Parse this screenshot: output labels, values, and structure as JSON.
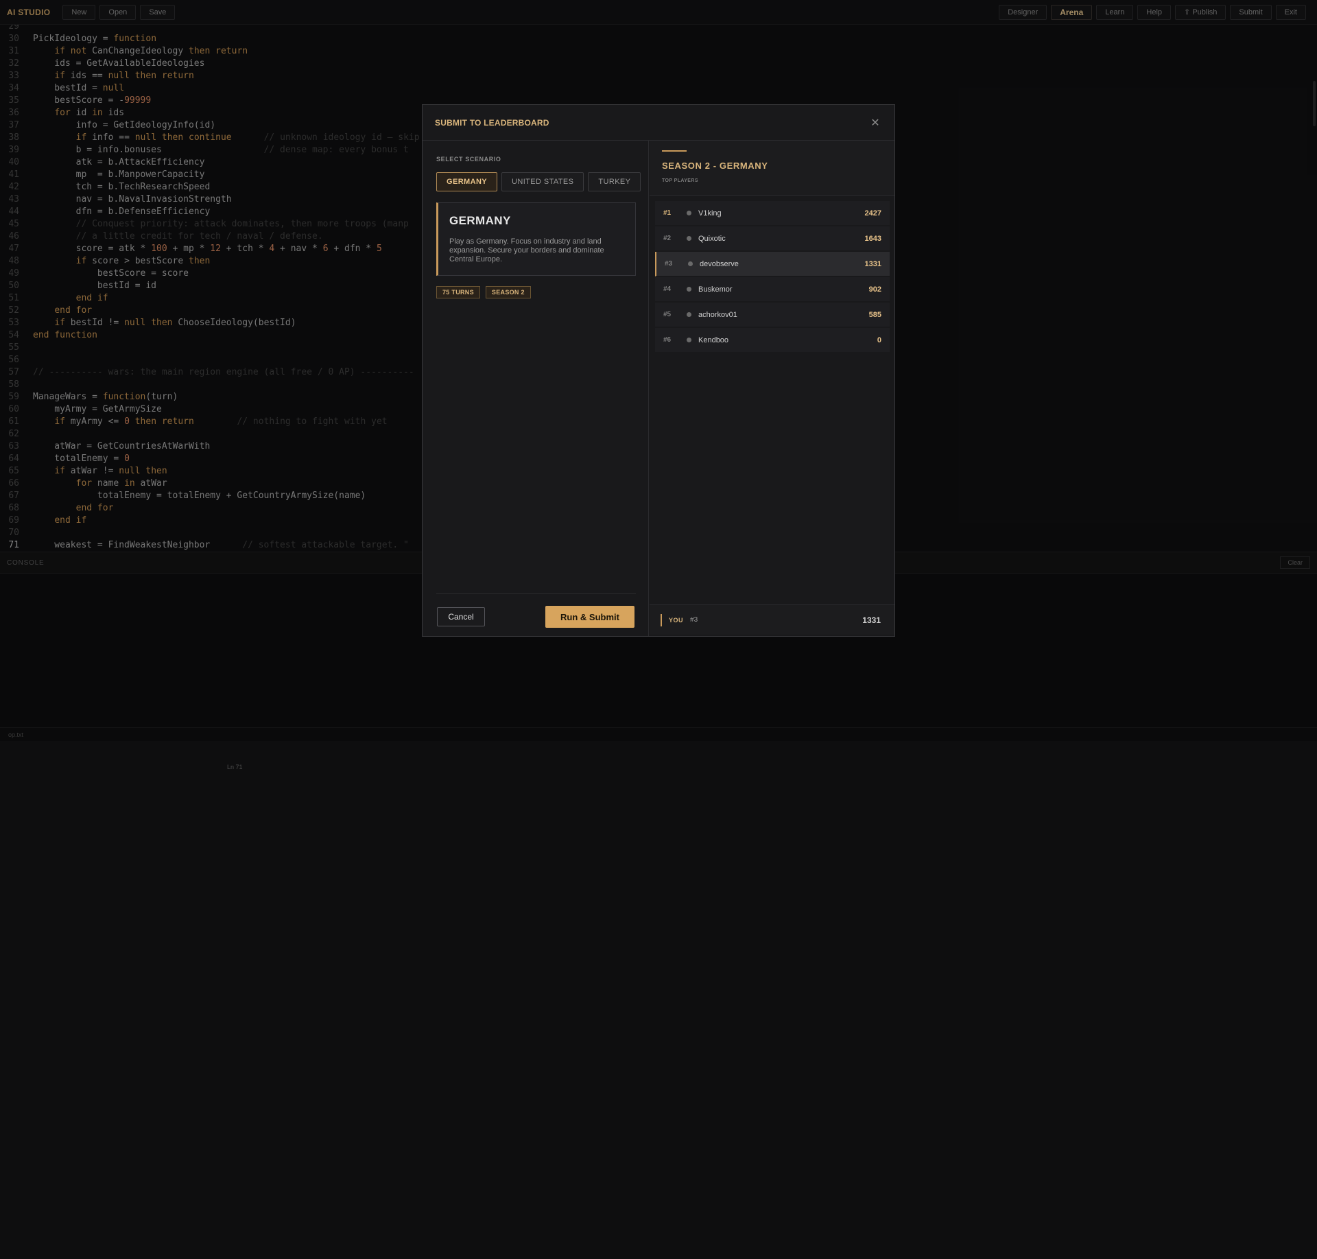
{
  "app": {
    "brand": "AI STUDIO",
    "left_buttons": [
      "New",
      "Open",
      "Save"
    ],
    "right_buttons": [
      "Designer",
      "Arena",
      "Learn",
      "Help",
      "⇧ Publish",
      "Submit",
      "Exit"
    ],
    "active_button": "Arena"
  },
  "editor": {
    "current_line": "71",
    "lines": [
      {
        "n": "29",
        "code": ""
      },
      {
        "n": "30",
        "code": "PickIdeology = function"
      },
      {
        "n": "31",
        "code": "    if not CanChangeIdeology then return"
      },
      {
        "n": "32",
        "code": "    ids = GetAvailableIdeologies"
      },
      {
        "n": "33",
        "code": "    if ids == null then return"
      },
      {
        "n": "34",
        "code": "    bestId = null"
      },
      {
        "n": "35",
        "code": "    bestScore = -99999"
      },
      {
        "n": "36",
        "code": "    for id in ids"
      },
      {
        "n": "37",
        "code": "        info = GetIdeologyInfo(id)"
      },
      {
        "n": "38",
        "code": "        if info == null then continue      // unknown ideology id — skip"
      },
      {
        "n": "39",
        "code": "        b = info.bonuses                   // dense map: every bonus t"
      },
      {
        "n": "40",
        "code": "        atk = b.AttackEfficiency"
      },
      {
        "n": "41",
        "code": "        mp  = b.ManpowerCapacity"
      },
      {
        "n": "42",
        "code": "        tch = b.TechResearchSpeed"
      },
      {
        "n": "43",
        "code": "        nav = b.NavalInvasionStrength"
      },
      {
        "n": "44",
        "code": "        dfn = b.DefenseEfficiency"
      },
      {
        "n": "45",
        "code": "        // Conquest priority: attack dominates, then more troops (manp"
      },
      {
        "n": "46",
        "code": "        // a little credit for tech / naval / defense."
      },
      {
        "n": "47",
        "code": "        score = atk * 100 + mp * 12 + tch * 4 + nav * 6 + dfn * 5"
      },
      {
        "n": "48",
        "code": "        if score > bestScore then"
      },
      {
        "n": "49",
        "code": "            bestScore = score"
      },
      {
        "n": "50",
        "code": "            bestId = id"
      },
      {
        "n": "51",
        "code": "        end if"
      },
      {
        "n": "52",
        "code": "    end for"
      },
      {
        "n": "53",
        "code": "    if bestId != null then ChooseIdeology(bestId)"
      },
      {
        "n": "54",
        "code": "end function"
      },
      {
        "n": "55",
        "code": ""
      },
      {
        "n": "56",
        "code": ""
      },
      {
        "n": "57",
        "code": "// ---------- wars: the main region engine (all free / 0 AP) ----------"
      },
      {
        "n": "58",
        "code": ""
      },
      {
        "n": "59",
        "code": "ManageWars = function(turn)"
      },
      {
        "n": "60",
        "code": "    myArmy = GetArmySize"
      },
      {
        "n": "61",
        "code": "    if myArmy <= 0 then return        // nothing to fight with yet"
      },
      {
        "n": "62",
        "code": ""
      },
      {
        "n": "63",
        "code": "    atWar = GetCountriesAtWarWith"
      },
      {
        "n": "64",
        "code": "    totalEnemy = 0"
      },
      {
        "n": "65",
        "code": "    if atWar != null then"
      },
      {
        "n": "66",
        "code": "        for name in atWar"
      },
      {
        "n": "67",
        "code": "            totalEnemy = totalEnemy + GetCountryArmySize(name)"
      },
      {
        "n": "68",
        "code": "        end for"
      },
      {
        "n": "69",
        "code": "    end if"
      },
      {
        "n": "70",
        "code": ""
      },
      {
        "n": "71",
        "code": "    weakest = FindWeakestNeighbor      // softest attackable target. \""
      }
    ]
  },
  "console": {
    "label": "CONSOLE",
    "clear_label": "Clear"
  },
  "status": {
    "file": "op.txt",
    "position": "Ln 71"
  },
  "modal": {
    "title": "SUBMIT TO LEADERBOARD",
    "scenario_label": "SELECT SCENARIO",
    "tabs": [
      "GERMANY",
      "UNITED STATES",
      "TURKEY"
    ],
    "selected_tab": "GERMANY",
    "card": {
      "title": "GERMANY",
      "description": "Play as Germany. Focus on industry and land expansion. Secure your borders and dominate Central Europe."
    },
    "pills": [
      "75 TURNS",
      "SEASON 2"
    ],
    "cancel_label": "Cancel",
    "submit_label": "Run & Submit",
    "leaderboard": {
      "title": "SEASON 2 - GERMANY",
      "subtitle": "TOP PLAYERS",
      "rows": [
        {
          "rank": "#1",
          "name": "V1king",
          "score": "2427"
        },
        {
          "rank": "#2",
          "name": "Quixotic",
          "score": "1643"
        },
        {
          "rank": "#3",
          "name": "devobserve",
          "score": "1331",
          "me": true
        },
        {
          "rank": "#4",
          "name": "Buskemor",
          "score": "902"
        },
        {
          "rank": "#5",
          "name": "achorkov01",
          "score": "585"
        },
        {
          "rank": "#6",
          "name": "Kendboo",
          "score": "0"
        }
      ],
      "you_label": "YOU",
      "you_rank": "#3",
      "you_score": "1331"
    }
  }
}
